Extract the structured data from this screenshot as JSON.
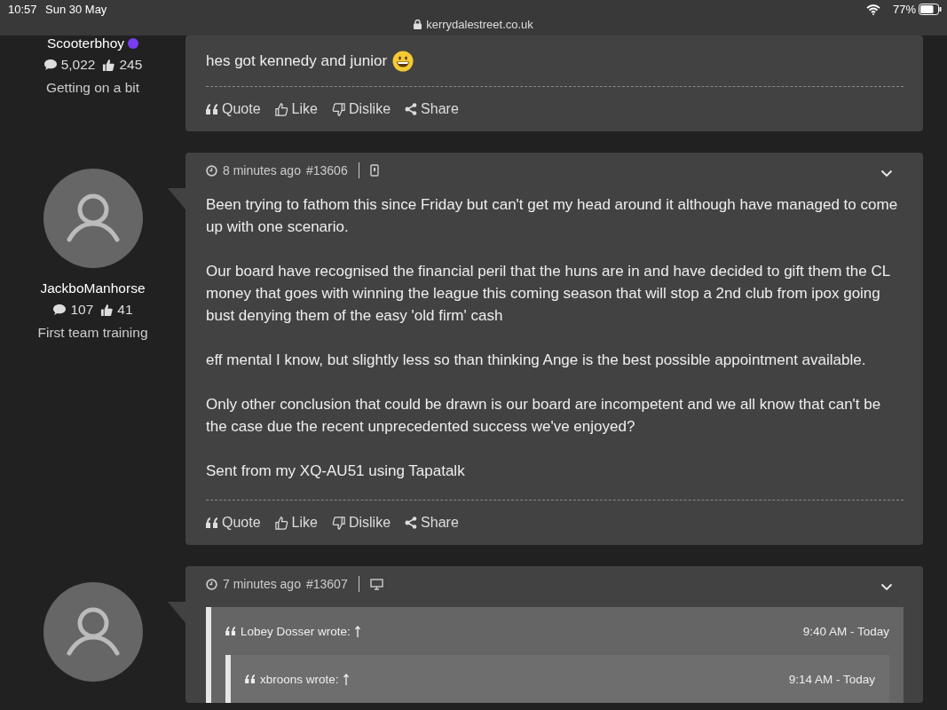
{
  "status_bar": {
    "time": "10:57",
    "date": "Sun 30 May",
    "url": "kerrydalestreet.co.uk",
    "battery": "77%"
  },
  "posts": [
    {
      "author": "Scooterbhoy",
      "online": true,
      "posts": "5,022",
      "likes": "245",
      "rank": "Getting on a bit",
      "paragraphs": [
        {
          "text": "hes got kennedy and junior",
          "emoji": true
        }
      ],
      "actions": [
        {
          "kind": "quote",
          "label": "Quote"
        },
        {
          "kind": "like",
          "label": "Like"
        },
        {
          "kind": "dislike",
          "label": "Dislike"
        },
        {
          "kind": "share",
          "label": "Share"
        }
      ]
    },
    {
      "author": "JackboManhorse",
      "posts": "107",
      "likes": "41",
      "rank": "First team training",
      "header": {
        "time": "8 minutes ago",
        "number": "#13606",
        "kind": "mobile"
      },
      "paragraphs": [
        "Been trying to fathom this since Friday but can't get my head around it although have managed to come up with one scenario.",
        "Our board have recognised the financial peril that the huns are in and have decided to gift them the CL money that goes with winning the league this coming season that will stop a 2nd club from ipox going bust denying them of the easy 'old firm' cash",
        "eff mental I know, but slightly less so than thinking Ange is the best possible appointment available.",
        "Only other conclusion that could be drawn is our board are incompetent and we all know that can't be the case due the recent unprecedented success we've enjoyed?",
        "Sent from my XQ-AU51 using Tapatalk"
      ],
      "actions": [
        {
          "kind": "quote",
          "label": "Quote"
        },
        {
          "kind": "like",
          "label": "Like"
        },
        {
          "kind": "dislike",
          "label": "Dislike"
        },
        {
          "kind": "share",
          "label": "Share"
        }
      ]
    },
    {
      "header": {
        "time": "7 minutes ago",
        "number": "#13607",
        "kind": "desktop"
      },
      "quotes": [
        {
          "author": "Lobey Dosser wrote:",
          "when": "9:40 AM - Today",
          "children": [
            {
              "author": "xbroons wrote:",
              "when": "9:14 AM - Today"
            }
          ]
        }
      ]
    }
  ]
}
